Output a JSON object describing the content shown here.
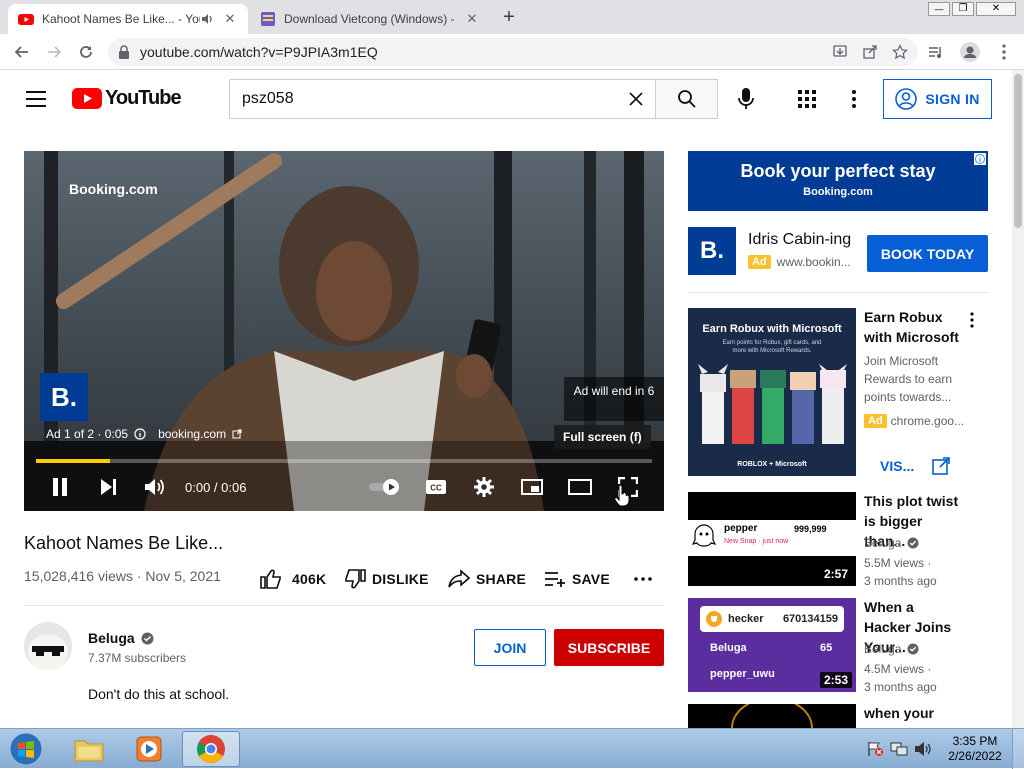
{
  "browser": {
    "tabs": [
      {
        "title": "Kahoot Names Be Like... - YouTube",
        "active": true
      },
      {
        "title": "Download Vietcong (Windows) - My Abandonware",
        "active": false
      }
    ],
    "new_tab": "+",
    "window_controls": {
      "minimize": "—",
      "restore": "❐",
      "close": "✕"
    },
    "url": "youtube.com/watch?v=P9JPIA3m1EQ"
  },
  "yt_header": {
    "logo_text": "YouTube",
    "search_value": "psz058",
    "sign_in": "SIGN IN"
  },
  "player": {
    "brand": "Booking.com",
    "logo_letter": "B.",
    "ad_info": "Ad 1 of 2 · 0:05",
    "ad_domain": "booking.com",
    "ad_end": "Ad will end in 6",
    "fullscreen_hint": "Full screen (f)",
    "time": "0:00 / 0:06",
    "progress_fraction": 0.12
  },
  "video": {
    "title": "Kahoot Names Be Like...",
    "views_date": "15,028,416 views · Nov 5, 2021",
    "likes": "406K",
    "dislike": "DISLIKE",
    "share": "SHARE",
    "save": "SAVE",
    "channel": "Beluga",
    "subscribers": "7.37M subscribers",
    "join": "JOIN",
    "subscribe": "SUBSCRIBE",
    "description": "Don't do this at school."
  },
  "sidebar": {
    "banner_title": "Book your perfect stay",
    "banner_sub": "Booking.com",
    "ad_title": "Idris Cabin-ing",
    "ad_badge": "Ad",
    "ad_url": "www.bookin...",
    "ad_cta": "BOOK TODAY",
    "ad_logo": "B.",
    "items": [
      {
        "title": "Earn Robux with Microsoft",
        "meta1": "Join Microsoft Rewards to earn points towards...",
        "badge": "Ad",
        "meta2": "chrome.goo...",
        "cta": "VIS...",
        "thumb_heading": "Earn Robux with Microsoft",
        "thumb_sub": "Earn points for Robux, gift cards, and more with Microsoft Rewards.",
        "thumb_footer": "ROBLOX + Microsoft"
      },
      {
        "title": "This plot twist is bigger than...",
        "channel": "Beluga",
        "views": "5.5M views ·",
        "age": "3 months ago",
        "duration": "2:57",
        "thumb_name": "pepper",
        "thumb_score": "999,999",
        "thumb_sub": "New Snap · just now"
      },
      {
        "title": "When a Hacker Joins Your...",
        "channel": "Beluga",
        "views": "4.5M views ·",
        "age": "3 months ago",
        "duration": "2:53",
        "thumb_name": "hecker",
        "thumb_score": "670134159",
        "thumb_row1": "Beluga",
        "thumb_row1_score": "65",
        "thumb_row2": "pepper_uwu"
      },
      {
        "title": "when your"
      }
    ]
  },
  "taskbar": {
    "time": "3:35 PM",
    "date": "2/26/2022"
  }
}
